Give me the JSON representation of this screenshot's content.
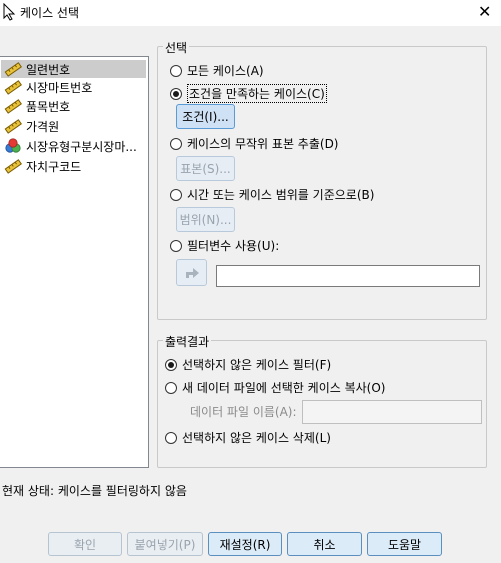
{
  "window": {
    "title": "케이스 선택",
    "close_glyph": "✕"
  },
  "variables": [
    {
      "label": "일련번호",
      "icon": "ruler-icon",
      "selected": true
    },
    {
      "label": "시장마트번호",
      "icon": "ruler-icon"
    },
    {
      "label": "품목번호",
      "icon": "ruler-icon"
    },
    {
      "label": "가격원",
      "icon": "ruler-icon"
    },
    {
      "label": "시장유형구분시장마...",
      "icon": "nominal-icon"
    },
    {
      "label": "자치구코드",
      "icon": "ruler-icon"
    }
  ],
  "select": {
    "legend": "선택",
    "all_cases": "모든 케이스(A)",
    "if_condition": "조건을 만족하는 케이스(C)",
    "if_button": "조건(I)...",
    "random_sample": "케이스의 무작위 표본 추출(D)",
    "sample_button": "표본(S)...",
    "range": "시간 또는 케이스 범위를 기준으로(B)",
    "range_button": "범위(N)...",
    "filter_var": "필터변수 사용(U):",
    "filter_value": ""
  },
  "output": {
    "legend": "출력결과",
    "filter_out": "선택하지 않은 케이스 필터(F)",
    "copy_to_new": "새 데이터 파일에 선택한 케이스 복사(O)",
    "dataset_name_label": "데이터 파일 이름(A):",
    "dataset_name_value": "",
    "delete": "선택하지 않은 케이스 삭제(L)"
  },
  "status": "현재 상태: 케이스를 필터링하지 않음",
  "buttons": {
    "ok": "확인",
    "paste": "붙여넣기(P)",
    "reset": "재설정(R)",
    "cancel": "취소",
    "help": "도움말"
  },
  "colors": {
    "window_bg": "#f0f0f0",
    "selected_item": "#cccccc",
    "ruler_icon": "#c49a00",
    "button_border_blue": "#3c7fb1"
  }
}
